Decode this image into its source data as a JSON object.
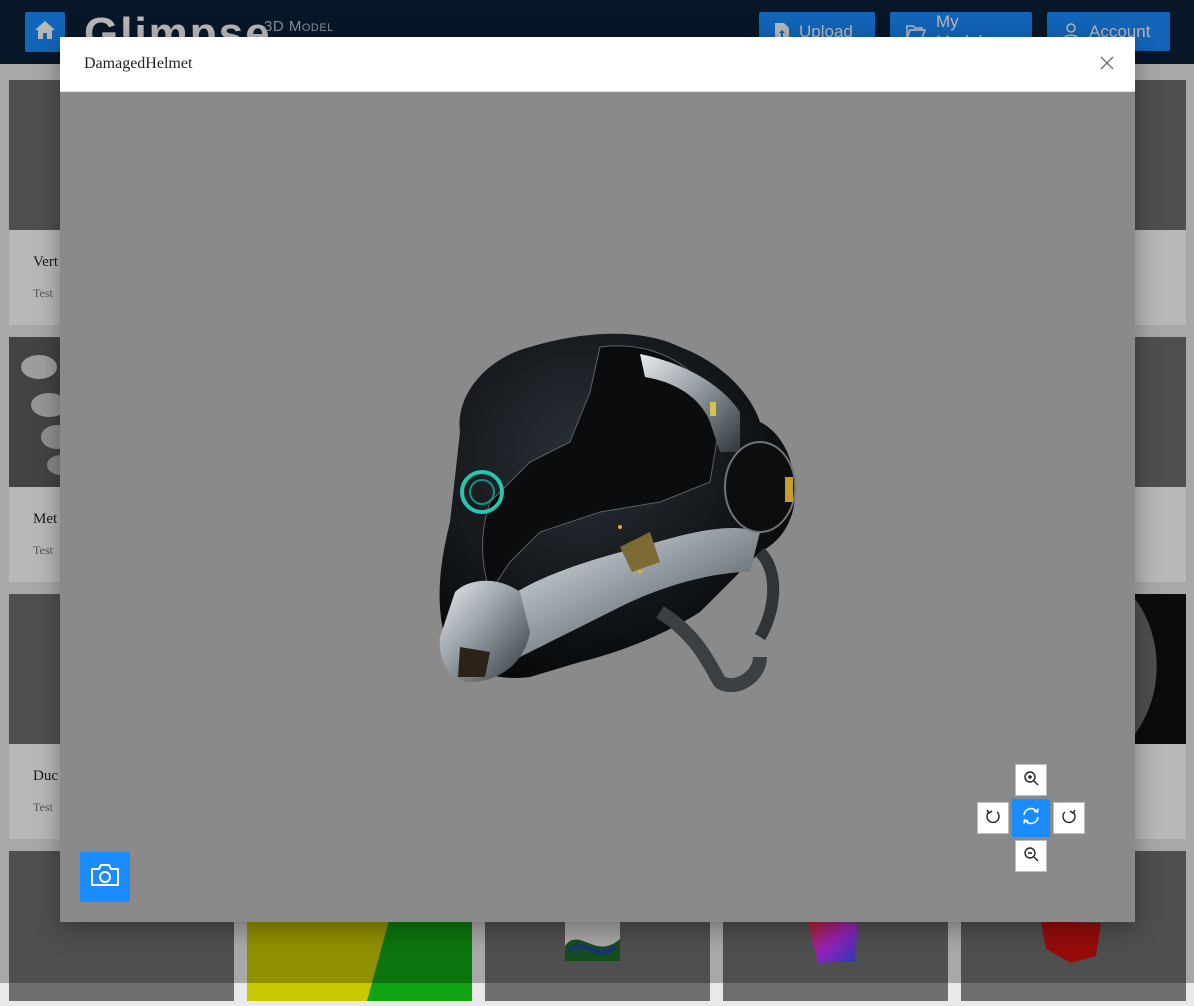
{
  "app": {
    "logo_text": "Glimpse",
    "logo_subtitle": "3D Model"
  },
  "nav": {
    "upload_label": "Upload",
    "my_models_label": "My Models",
    "account_label": "Account"
  },
  "gallery": {
    "cards": [
      {
        "title": "Vert",
        "subtitle": "Test"
      },
      {
        "title": "Met",
        "subtitle": "Test"
      },
      {
        "title": "Duc",
        "subtitle": "Test"
      }
    ]
  },
  "modal": {
    "title": "DamagedHelmet"
  },
  "viewer_controls": {
    "icons": [
      "zoom-in-icon",
      "rotate-left-icon",
      "auto-rotate-icon",
      "rotate-right-icon",
      "zoom-out-icon",
      "camera-icon"
    ],
    "active": "auto-rotate-icon"
  },
  "colors": {
    "accent": "#1a8cff",
    "topbar": "#0c2038",
    "viewer_background": "#8a8a8a"
  }
}
